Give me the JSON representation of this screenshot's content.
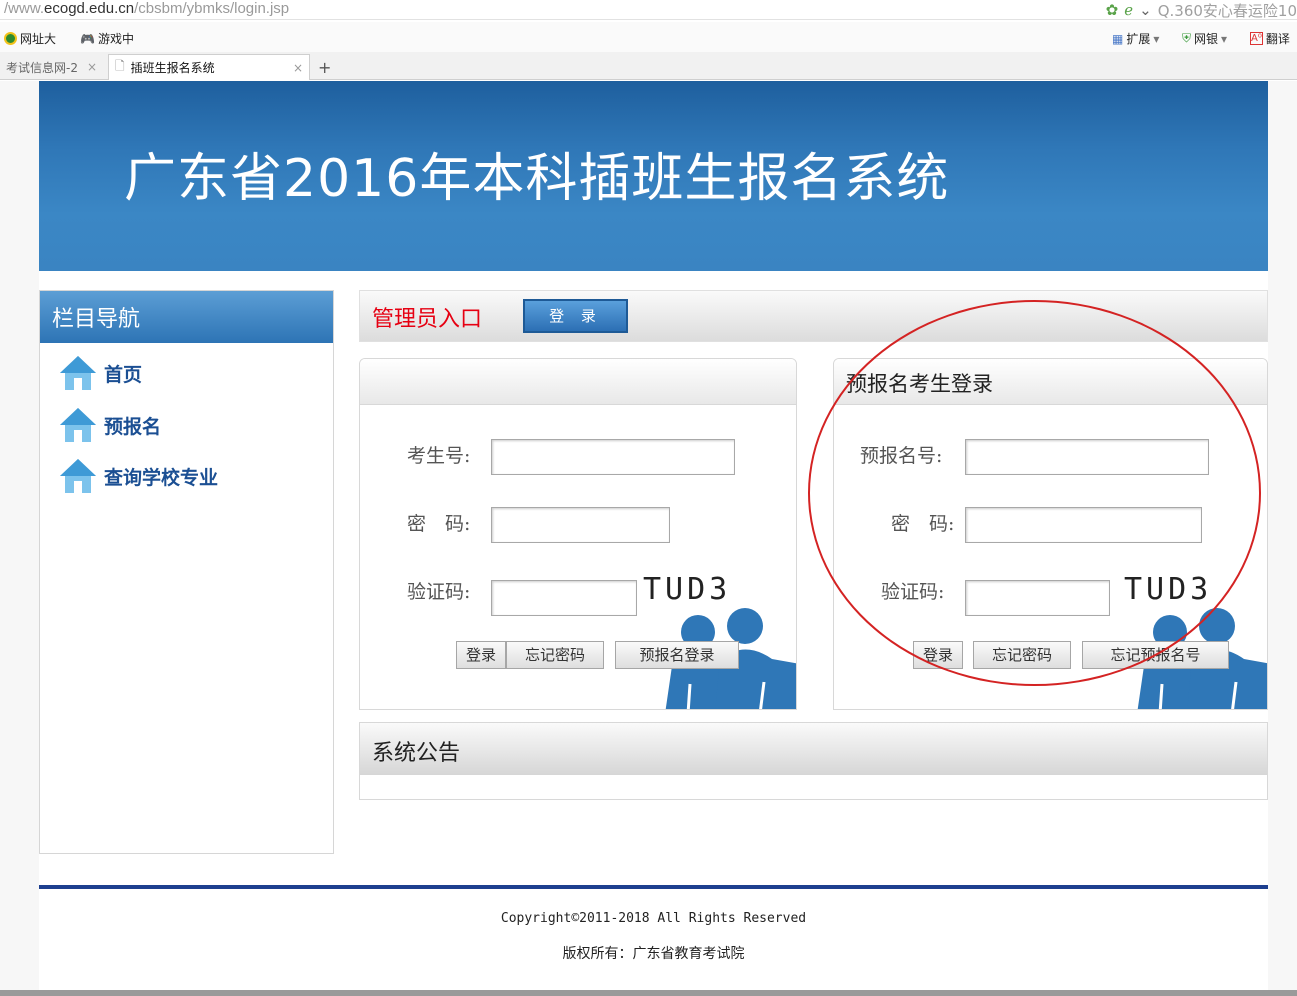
{
  "browser": {
    "url_prefix": "/www.",
    "url_domain": "ecogd.edu.cn",
    "url_path": "/cbsbm/ybmks/login.jsp",
    "search_text": "Q.360安心春运险10",
    "bookmarks": [
      "网址大",
      "游戏中"
    ],
    "toolbar_items": [
      "扩展",
      "网银",
      "翻译"
    ],
    "tabs": [
      {
        "label": "考试信息网-2"
      },
      {
        "label": "插班生报名系统"
      }
    ],
    "new_tab": "+"
  },
  "banner": {
    "title": "广东省2016年本科插班生报名系统"
  },
  "sidebar": {
    "title": "栏目导航",
    "items": [
      {
        "label": "首页"
      },
      {
        "label": "预报名"
      },
      {
        "label": "查询学校专业"
      }
    ]
  },
  "admin": {
    "label": "管理员入口",
    "button": "登 录"
  },
  "login_panel": {
    "title": "",
    "id_label": "考生号:",
    "password_label": "密　码:",
    "captcha_label": "验证码:",
    "captcha_text": "TUD3",
    "buttons": {
      "login": "登录",
      "forgot": "忘记密码",
      "pre_login": "预报名登录"
    }
  },
  "pre_panel": {
    "title": "预报名考生登录",
    "id_label": "预报名号:",
    "password_label": "密　码:",
    "captcha_label": "验证码:",
    "captcha_text": "TUD3",
    "buttons": {
      "login": "登录",
      "forgot": "忘记密码",
      "forgot_no": "忘记预报名号"
    }
  },
  "notice": {
    "title": "系统公告"
  },
  "footer": {
    "copyright": "Copyright©2011-2018 All Rights Reserved",
    "owner": "版权所有：广东省教育考试院"
  },
  "colors": {
    "banner": "#2f77b7",
    "admin_label": "#e60012",
    "nav_text": "#1b4f93",
    "annotation": "#d42323"
  }
}
